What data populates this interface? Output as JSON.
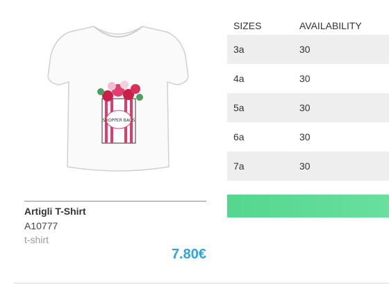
{
  "product": {
    "name": "Artigli T-Shirt",
    "code": "A10777",
    "category": "t-shirt",
    "price": "7.80€",
    "image_text": "SHOPPER BAGS",
    "accent_color": "#2aa5e0"
  },
  "table": {
    "headers": {
      "sizes": "SIZES",
      "availability": "AVAILABILITY"
    },
    "rows": [
      {
        "size": "3a",
        "availability": "30"
      },
      {
        "size": "4a",
        "availability": "30"
      },
      {
        "size": "5a",
        "availability": "30"
      },
      {
        "size": "6a",
        "availability": "30"
      },
      {
        "size": "7a",
        "availability": "30"
      }
    ]
  },
  "action": {
    "button_label": "",
    "button_color": "#5bd993"
  }
}
